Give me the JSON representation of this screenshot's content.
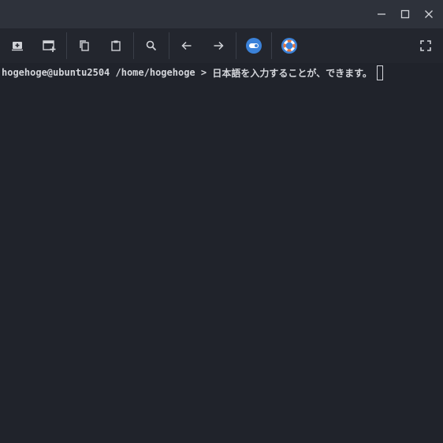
{
  "titlebar": {
    "buttons": [
      {
        "name": "minimize",
        "icon": "minimize-icon"
      },
      {
        "name": "maximize",
        "icon": "maximize-icon"
      },
      {
        "name": "close",
        "icon": "close-icon"
      }
    ]
  },
  "toolbar": {
    "buttons": [
      {
        "name": "new-tab",
        "icon": "new-tab-icon"
      },
      {
        "name": "new-window",
        "icon": "new-window-icon"
      },
      {
        "name": "copy",
        "icon": "copy-icon"
      },
      {
        "name": "paste",
        "icon": "paste-icon"
      },
      {
        "name": "search",
        "icon": "search-icon"
      },
      {
        "name": "back",
        "icon": "arrow-left-icon"
      },
      {
        "name": "forward",
        "icon": "arrow-right-icon"
      },
      {
        "name": "toggle",
        "icon": "toggle-icon"
      },
      {
        "name": "help",
        "icon": "lifebuoy-icon"
      },
      {
        "name": "fullscreen",
        "icon": "fullscreen-icon"
      }
    ],
    "accent_color": "#3b82d9"
  },
  "terminal": {
    "prompt": "hogehoge@ubuntu2504 /home/hogehoge > ",
    "input": "日本語を入力することが、できます。",
    "background": "#20232b",
    "foreground": "#d3d5da"
  }
}
